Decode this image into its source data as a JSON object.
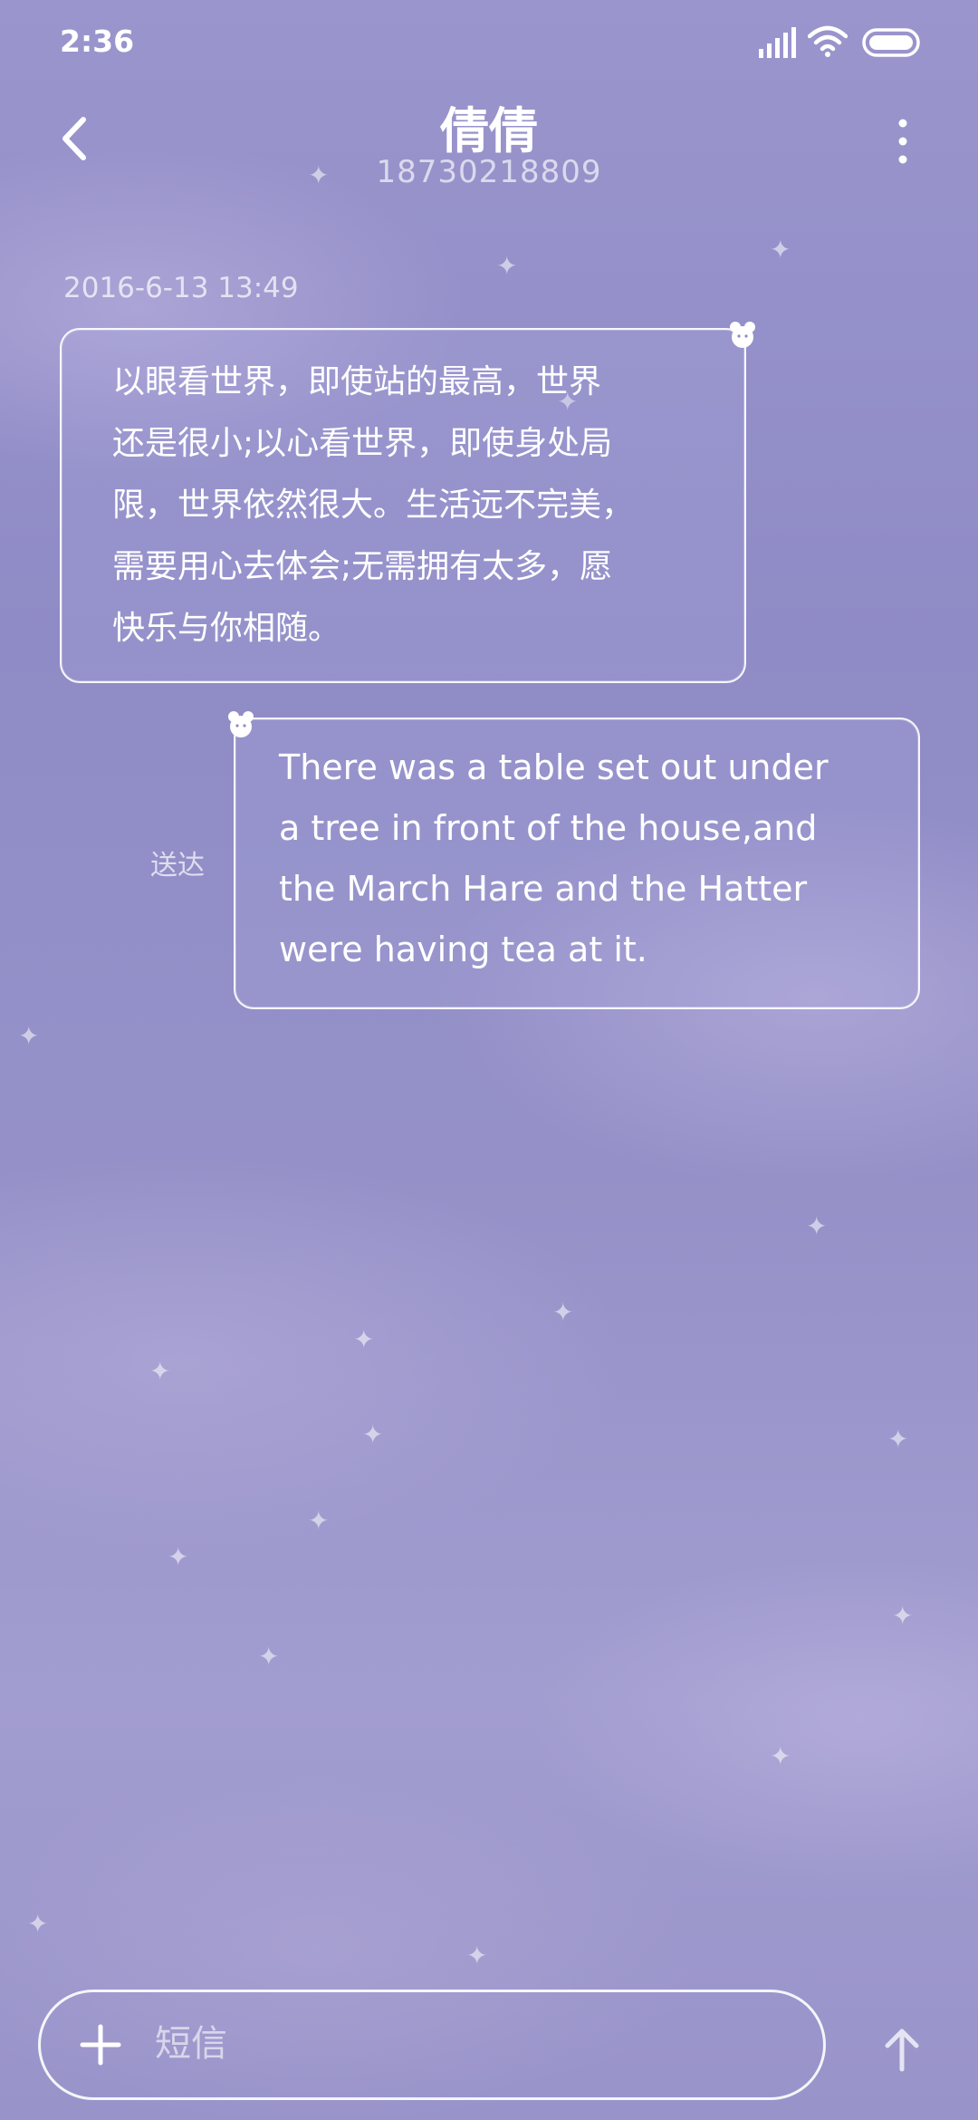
{
  "status_bar": {
    "time": "2:36"
  },
  "header": {
    "title": "倩倩",
    "subtitle": "18730218809"
  },
  "messages": [
    {
      "timestamp": "2016-6-13 13:49",
      "lines": [
        "以眼看世界，即使站的最高，世界",
        "还是很小;以心看世界，即使身处局",
        "限，世界依然很大。生活远不完美，",
        "需要用心去体会;无需拥有太多，愿",
        "快乐与你相随。"
      ]
    },
    {
      "status": "送达",
      "lines": [
        "There was a table set out under",
        "a tree in front of the house,and",
        "the March Hare and the Hatter",
        "were having tea at it."
      ]
    }
  ],
  "composer": {
    "placeholder": "短信"
  },
  "icons": {
    "back": "chevron-left-icon",
    "more": "more-vertical-icon",
    "add": "plus-icon",
    "send": "arrow-up-icon"
  }
}
